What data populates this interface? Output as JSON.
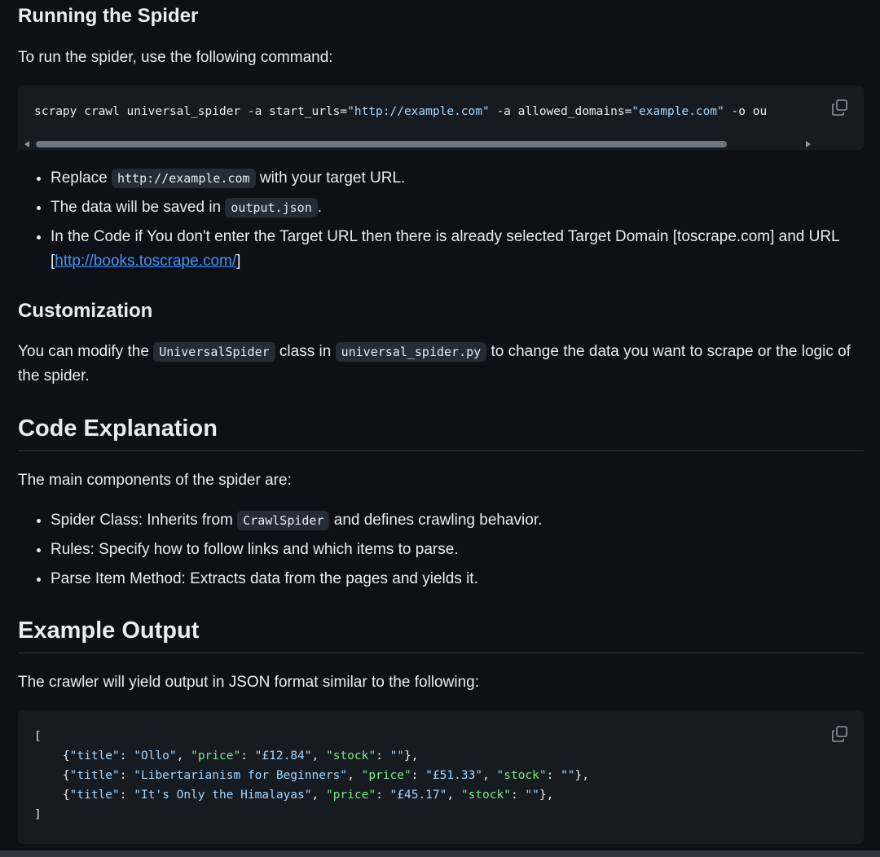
{
  "running": {
    "heading": "Running the Spider",
    "intro": "To run the spider, use the following command:",
    "command": {
      "c1": "scrapy crawl universal_spider -a start_urls=",
      "s1": "\"http://example.com\"",
      "c2": " -a allowed_domains=",
      "s2": "\"example.com\"",
      "c3": " -o ou"
    },
    "bullets": [
      {
        "pre": "Replace ",
        "code": "http://example.com",
        "post": " with your target URL."
      },
      {
        "pre": "The data will be saved in ",
        "code": "output.json",
        "post": "."
      },
      {
        "pre": "In the Code if You don't enter the Target URL then there is already selected Target Domain [toscrape.com] and URL [",
        "link": "http://books.toscrape.com/",
        "post": "]"
      }
    ]
  },
  "customization": {
    "heading": "Customization",
    "t1": "You can modify the ",
    "code1": "UniversalSpider",
    "t2": " class in ",
    "code2": "universal_spider.py",
    "t3": " to change the data you want to scrape or the logic of the spider."
  },
  "code_explanation": {
    "heading": "Code Explanation",
    "intro": "The main components of the spider are:",
    "bullets": [
      {
        "pre": "Spider Class: Inherits from ",
        "code": "CrawlSpider",
        "post": " and defines crawling behavior."
      },
      {
        "text": "Rules: Specify how to follow links and which items to parse."
      },
      {
        "text": "Parse Item Method: Extracts data from the pages and yields it."
      }
    ]
  },
  "example_output": {
    "heading": "Example Output",
    "intro": "The crawler will yield output in JSON format similar to the following:",
    "open": "[",
    "close": "]",
    "rows": [
      {
        "title": "\"Ollo\"",
        "price": "\"£12.84\"",
        "stock": "\"\""
      },
      {
        "title": "\"Libertarianism for Beginners\"",
        "price": "\"£51.33\"",
        "stock": "\"\""
      },
      {
        "title": "\"It's Only the Himalayas\"",
        "price": "\"£45.17\"",
        "stock": "\"\""
      }
    ],
    "keys": {
      "title": "\"title\"",
      "price": "\"price\"",
      "stock": "\"stock\""
    }
  },
  "icons": {
    "copy": "copy-icon"
  },
  "colors": {
    "background": "#0d1117",
    "code_bg": "#161b22",
    "string": "#a5d6ff",
    "key": "#7ee787",
    "link": "#4493f8"
  }
}
